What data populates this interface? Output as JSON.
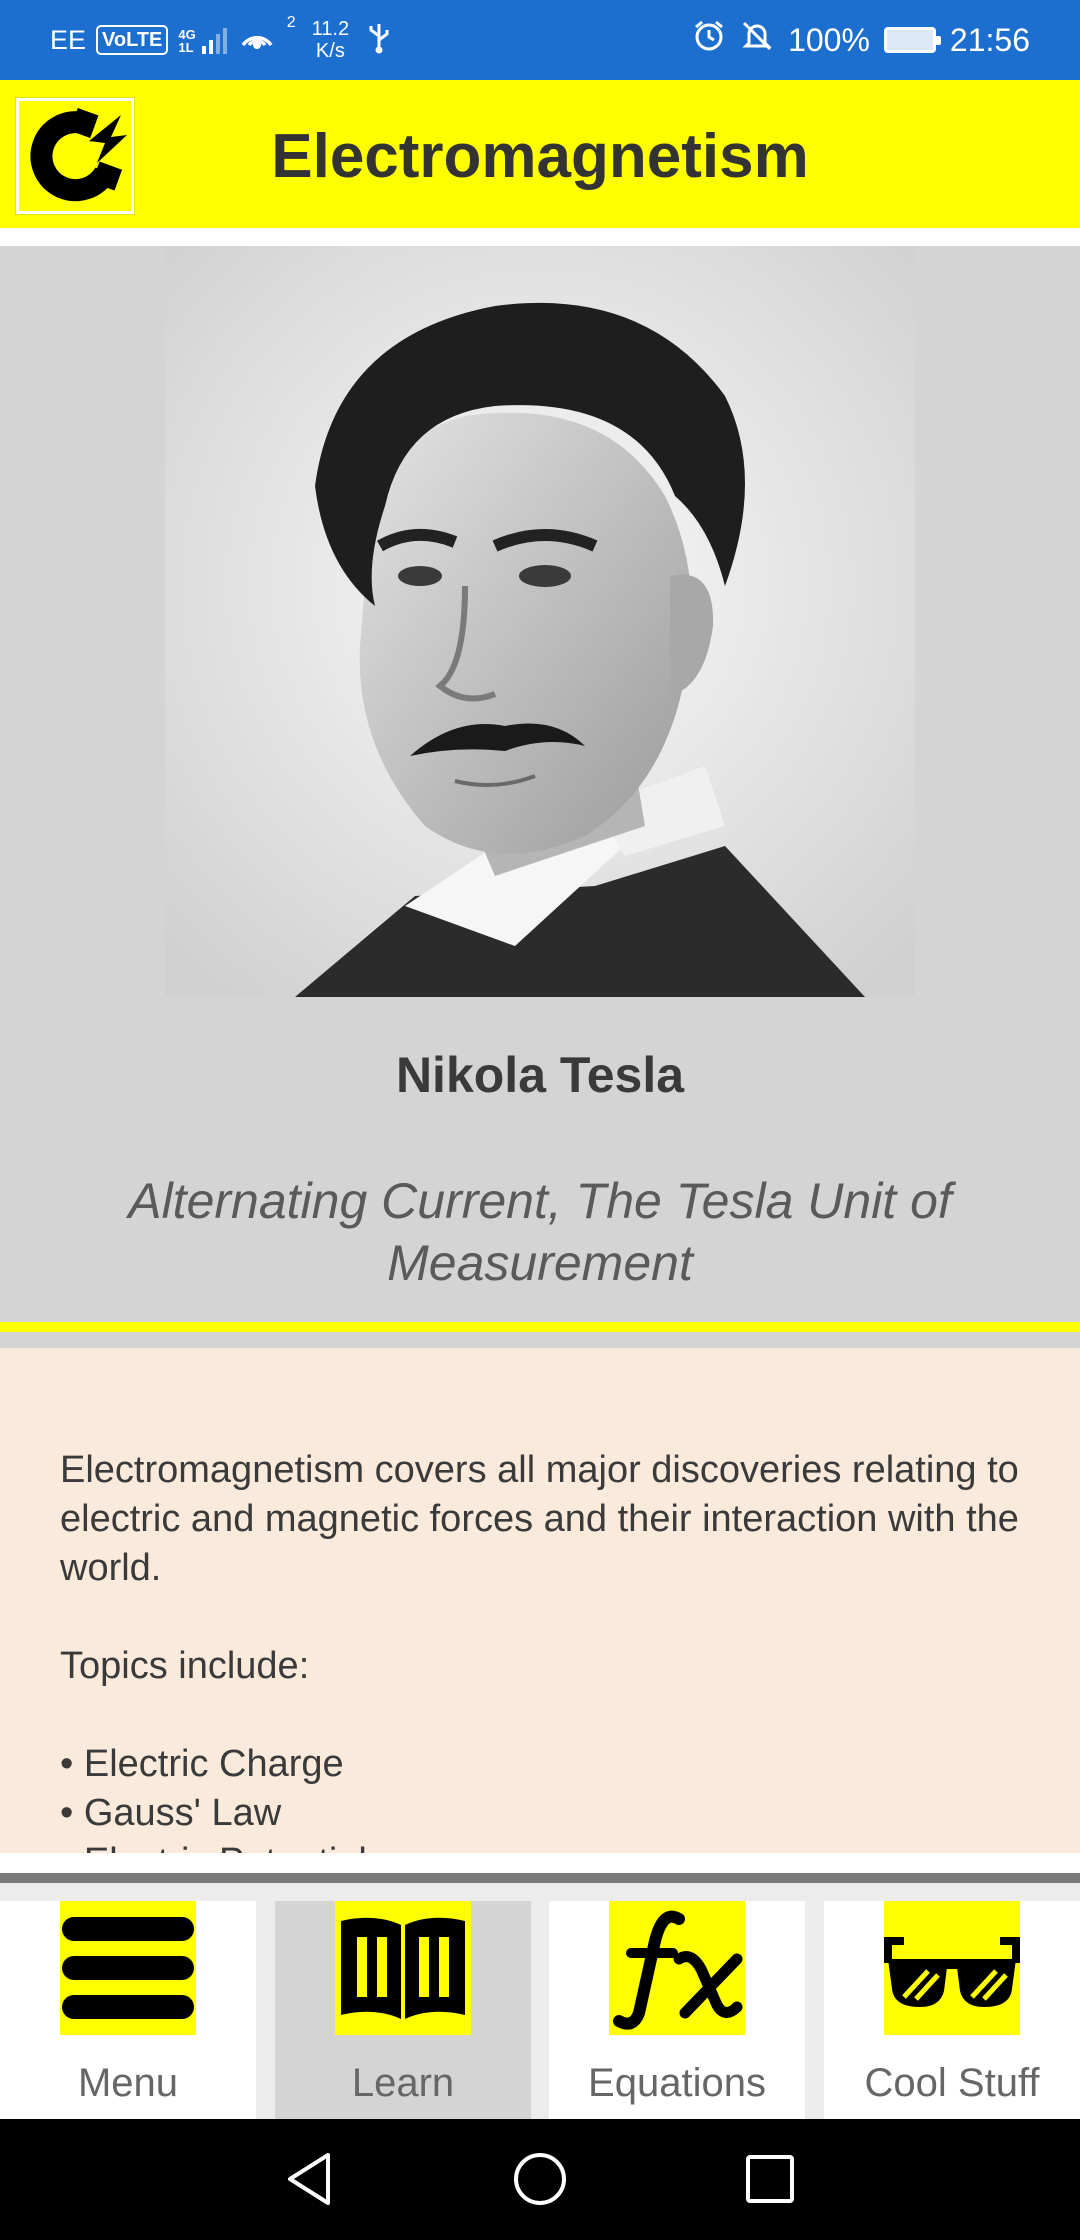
{
  "status_bar": {
    "carrier": "EE",
    "volte": "VoLTE",
    "network_type": "4G",
    "network_sub": "1L",
    "hotspot_count": "2",
    "speed_value": "11.2",
    "speed_unit": "K/s",
    "battery": "100%",
    "time": "21:56",
    "icons": [
      "volte-icon",
      "signal-icon",
      "hotspot-icon",
      "usb-icon",
      "alarm-icon",
      "mute-icon",
      "battery-charging-icon"
    ]
  },
  "app_bar": {
    "title": "Electromagnetism",
    "logo_icon": "magnet-logo-icon"
  },
  "hero": {
    "image_icon": "nikola-tesla-portrait",
    "name": "Nikola Tesla",
    "subtitle": "Alternating Current, The Tesla Unit of Measurement"
  },
  "content": {
    "intro": "Electromagnetism covers all major discoveries relating to electric and magnetic forces and their interaction with the world.",
    "topics_heading": "Topics include:",
    "topics": [
      "• Electric Charge",
      "• Gauss' Law",
      "• Electric Potential"
    ]
  },
  "bottom_nav": {
    "items": [
      {
        "label": "Menu",
        "icon": "menu-icon",
        "active": false
      },
      {
        "label": "Learn",
        "icon": "book-icon",
        "active": true
      },
      {
        "label": "Equations",
        "icon": "function-icon",
        "active": false
      },
      {
        "label": "Cool Stuff",
        "icon": "sunglasses-icon",
        "active": false
      }
    ]
  },
  "system_nav": {
    "icons": [
      "back-icon",
      "home-icon",
      "recents-icon"
    ]
  },
  "colors": {
    "status_bar": "#1c6fcf",
    "accent_yellow": "#ffff00",
    "hero_bg": "#d4d4d4",
    "content_bg": "#f9eadb",
    "text_dark": "#333333"
  }
}
